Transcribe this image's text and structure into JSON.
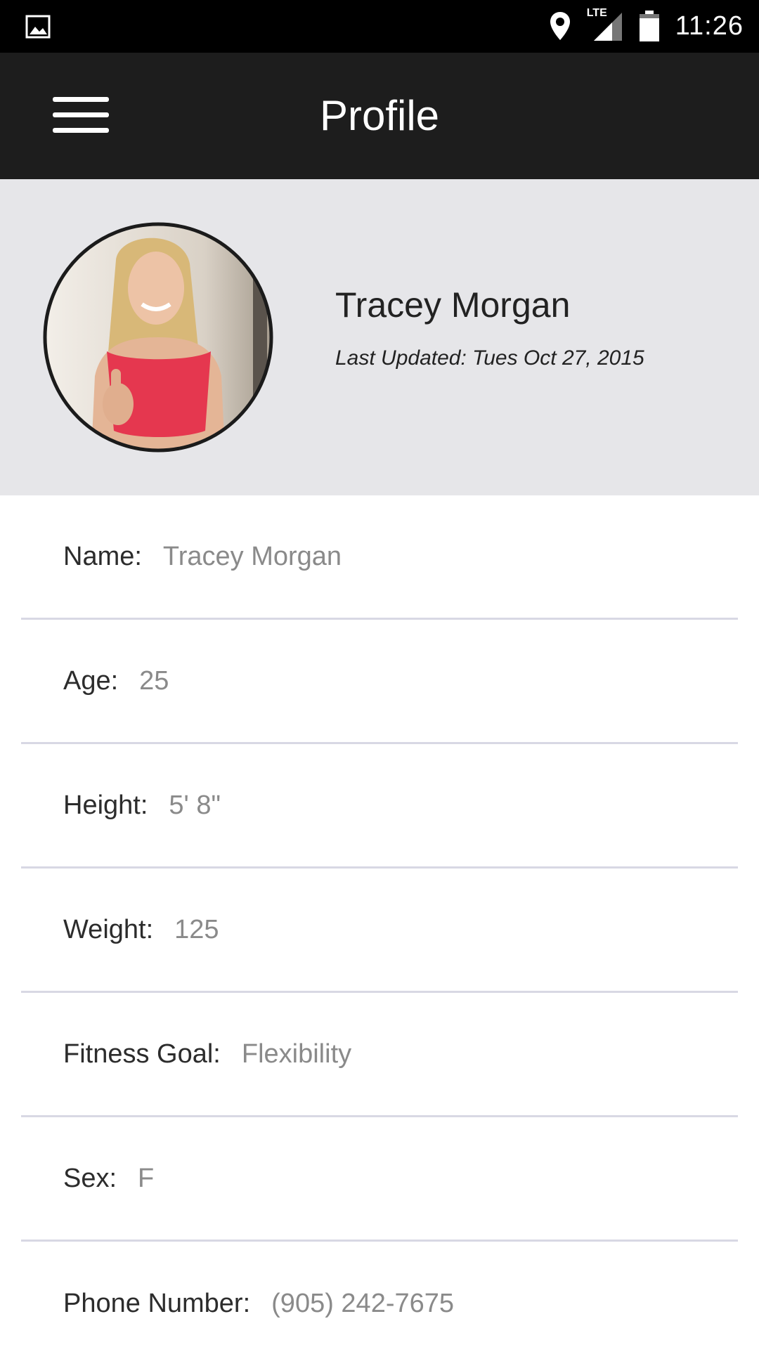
{
  "status_bar": {
    "time": "11:26",
    "network_label": "LTE",
    "icons": [
      "image-icon",
      "location-pin-icon",
      "signal-icon",
      "battery-icon"
    ]
  },
  "app_bar": {
    "title": "Profile",
    "menu_icon": "hamburger-menu-icon"
  },
  "profile_header": {
    "name": "Tracey Morgan",
    "last_updated": "Last Updated: Tues Oct 27, 2015"
  },
  "fields": [
    {
      "label": "Name:",
      "value": "Tracey Morgan"
    },
    {
      "label": "Age:",
      "value": "25"
    },
    {
      "label": "Height:",
      "value": "5' 8\""
    },
    {
      "label": "Weight:",
      "value": "125"
    },
    {
      "label": "Fitness Goal:",
      "value": "Flexibility"
    },
    {
      "label": "Sex:",
      "value": "F"
    },
    {
      "label": "Phone Number:",
      "value": "(905) 242-7675"
    }
  ],
  "colors": {
    "status_bar_bg": "#000000",
    "app_bar_bg": "#1d1d1d",
    "header_bg": "#e6e6e9",
    "divider": "#d8d8e4",
    "value_text": "#8a8a8a",
    "avatar_top": "#e8e2dc",
    "avatar_shirt": "#e5374f"
  }
}
